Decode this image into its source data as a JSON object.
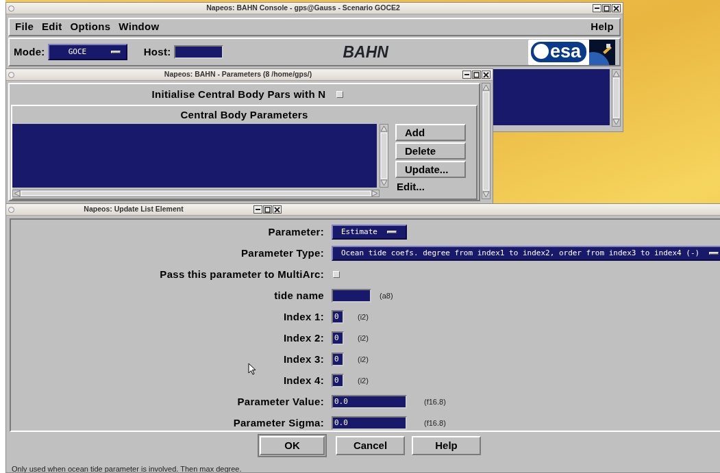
{
  "console": {
    "title": "Napeos: BAHN Console - gps@Gauss - Scenario GOCE2",
    "menu": [
      {
        "label": "File"
      },
      {
        "label": "Edit"
      },
      {
        "label": "Options"
      },
      {
        "label": "Window"
      }
    ],
    "help_menu": "Help",
    "mode": {
      "label": "Mode:",
      "value": "GOCE"
    },
    "host": {
      "label": "Host:"
    },
    "app_name": "BAHN",
    "logo": "esa"
  },
  "parameters_window": {
    "title": "Napeos: BAHN - Parameters (8 /home/gps/)",
    "initialise": {
      "label": "Initialise Central Body Pars with N",
      "checked": false
    },
    "group_title": "Central Body Parameters",
    "actions": [
      {
        "label": "Add",
        "kind": "button"
      },
      {
        "label": "Delete",
        "kind": "button"
      },
      {
        "label": "Update...",
        "kind": "button"
      },
      {
        "label": "Edit...",
        "kind": "flat"
      }
    ]
  },
  "update_dialog": {
    "title": "Napeos: Update List Element",
    "fields": [
      {
        "kind": "option",
        "label": "Parameter:",
        "value": "Estimate"
      },
      {
        "kind": "wideoption",
        "label": "Parameter Type:",
        "value": "Ocean tide coefs. degree from index1 to index2, order from index3 to index4 (-)"
      },
      {
        "kind": "checkbox",
        "label": "Pass this parameter to MultiArc:",
        "checked": false
      },
      {
        "kind": "textentry",
        "label": "tide name",
        "format": "(a8)"
      },
      {
        "kind": "intentry",
        "label": "Index 1:",
        "value": "0",
        "format": "(i2)"
      },
      {
        "kind": "intentry",
        "label": "Index 2:",
        "value": "0",
        "format": "(i2)"
      },
      {
        "kind": "intentry",
        "label": "Index 3:",
        "value": "0",
        "format": "(i2)"
      },
      {
        "kind": "intentry",
        "label": "Index 4:",
        "value": "0",
        "format": "(i2)"
      },
      {
        "kind": "realentry",
        "label": "Parameter Value:",
        "value": "0.0",
        "format": "(f16.8)"
      },
      {
        "kind": "realentry",
        "label": "Parameter Sigma:",
        "value": "0.0",
        "format": "(f16.8)"
      }
    ],
    "buttons": [
      {
        "label": "OK",
        "default": true
      },
      {
        "label": "Cancel",
        "default": false
      },
      {
        "label": "Help",
        "default": false
      }
    ],
    "status": "Only used when ocean tide parameter is involved. Then max degree."
  }
}
